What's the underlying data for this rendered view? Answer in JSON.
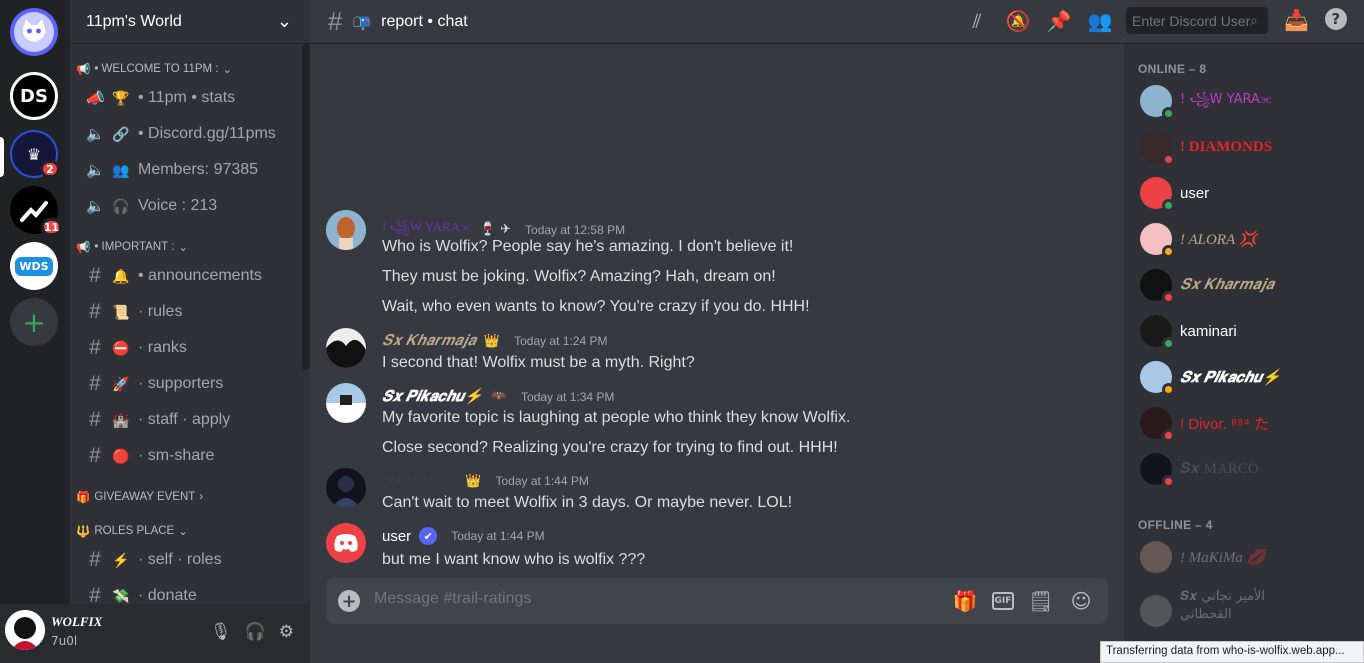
{
  "servers": {
    "items": [
      {
        "name": "home",
        "badge": ""
      },
      {
        "name": "DS",
        "badge": ""
      },
      {
        "name": "11pm",
        "badge": "2"
      },
      {
        "name": "chart",
        "badge": "11"
      },
      {
        "name": "WDS",
        "badge": ""
      }
    ],
    "add_label": "+"
  },
  "guild": {
    "name": "11pm's World"
  },
  "categories": {
    "welcome": "• WELCOME TO 11PM :",
    "important": "• IMPORTANT :",
    "giveaway": "GIVEAWAY EVENT",
    "roles": "ROLES PLACE"
  },
  "channels": [
    {
      "emoji": "🏆",
      "label": "• 11pm • stats",
      "type": "voice"
    },
    {
      "emoji": "🔗",
      "label": "• Discord.gg/11pms",
      "type": "voice"
    },
    {
      "emoji": "👥",
      "label": "Members: 97385",
      "type": "voice"
    },
    {
      "emoji": "🎧",
      "label": "Voice : 213",
      "type": "voice"
    },
    {
      "emoji": "🔔",
      "label": "• announcements",
      "type": "text"
    },
    {
      "emoji": "📜",
      "label": "· rules",
      "type": "text"
    },
    {
      "emoji": "⛔",
      "label": "· ranks",
      "type": "text"
    },
    {
      "emoji": "🚀",
      "label": "· supporters",
      "type": "text"
    },
    {
      "emoji": "🏰",
      "label": "· staff · apply",
      "type": "text"
    },
    {
      "emoji": "🔴",
      "label": "· sm-share",
      "type": "text"
    },
    {
      "emoji": "⚡",
      "label": "· self · roles",
      "type": "text"
    },
    {
      "emoji": "💸",
      "label": "· donate",
      "type": "text"
    }
  ],
  "user": {
    "name": "WOLFIX",
    "tag": "7u0l"
  },
  "header": {
    "channel_emoji": "📭",
    "channel_name": "report • chat",
    "search_placeholder": "Enter Discord User"
  },
  "messages": [
    {
      "author": "! ꧁W YARA⫘",
      "author_color": "#6b2fb3",
      "badge": "🍷 ✈",
      "time": "Today at 12:58 PM",
      "lines": [
        "Who is Wolfix? People say he's amazing. I don't believe it!",
        "They must be joking. Wolfix? Amazing? Hah, dream on!",
        "Wait, who even wants to know? You're crazy if you do. HHH!"
      ]
    },
    {
      "author": "𝑺𝒙 𝑲𝒉𝒂𝒓𝒎𝒂𝒋𝒂",
      "author_color": "#b9a98a",
      "badge": "👑",
      "time": "Today at 1:24 PM",
      "lines": [
        "I second that! Wolfix must be a myth. Right?"
      ]
    },
    {
      "author": "𝑺𝒙 𝑷𝒊𝒌𝒂𝒄𝒉𝒖⚡",
      "author_color": "#ffffff",
      "badge": "🦇",
      "time": "Today at 1:34 PM",
      "lines": [
        "My favorite topic is laughing at people who think they know Wolfix.",
        "Close second? Realizing you're crazy for trying to find out. HHH!"
      ]
    },
    {
      "author": "𝑺𝒙 MARCO",
      "author_color": "#3a3c42",
      "badge": "👑",
      "time": "Today at 1:44 PM",
      "lines": [
        "Can't wait to meet Wolfix in 3 days. Or maybe never. LOL!"
      ]
    },
    {
      "author": "user",
      "author_color": "#ffffff",
      "badge": "✔",
      "time": "Today at 1:44 PM",
      "lines": [
        "but me I want know who is wolfix ???"
      ]
    }
  ],
  "composer": {
    "placeholder": "Message #trail-ratings"
  },
  "members": {
    "online_label": "ONLINE – 8",
    "offline_label": "OFFLINE – 4",
    "online": [
      {
        "name": "! ꧁W YARA⫘",
        "color": "#b93cc8",
        "status": "#3ba55d"
      },
      {
        "name": "! DIAMONDS",
        "color": "#e2252b",
        "status": "#ed4245"
      },
      {
        "name": "user",
        "color": "#ffffff",
        "status": "#3ba55d"
      },
      {
        "name": "! ALORA 💢",
        "color": "#b9a98a",
        "status": "#faa81a"
      },
      {
        "name": "𝑺𝒙 𝑲𝒉𝒂𝒓𝒎𝒂𝒋𝒂",
        "color": "#b9a98a",
        "status": "#ed4245"
      },
      {
        "name": "kaminari",
        "color": "#ffffff",
        "status": "#3ba55d"
      },
      {
        "name": "𝑺𝒙 𝑷𝒊𝒌𝒂𝒄𝒉𝒖⚡",
        "color": "#ffffff",
        "status": "#faa81a"
      },
      {
        "name": "! Divor. ⁸⁸⁴ た",
        "color": "#e2252b",
        "status": "#ed4245"
      },
      {
        "name": "𝑺𝒙 MARCO",
        "color": "#4a4c52",
        "status": "#ed4245"
      }
    ],
    "offline": [
      {
        "name": "! MaKiMa 💋",
        "color": "#b9bbbe"
      },
      {
        "name": "𝑺𝒙 الأمير تجاني القحطاني",
        "color": "#b9bbbe"
      }
    ]
  },
  "status_bar": {
    "text": "Transferring data from who-is-wolfix.web.app..."
  }
}
